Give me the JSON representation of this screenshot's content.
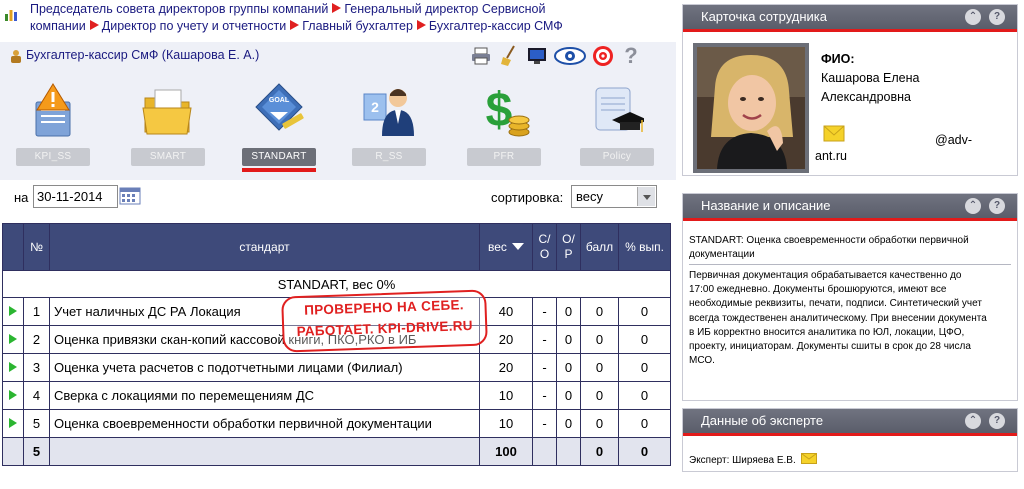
{
  "breadcrumb": {
    "line1": [
      "Председатель совета директоров группы компаний",
      "Генеральный директор Сервисной"
    ],
    "line2": [
      "компании",
      "Директор по учету и отчетности",
      "Главный бухгалтер",
      "Бухгалтер-кассир СМФ"
    ]
  },
  "user": {
    "name": "Бухгалтер-кассир СмФ  (Кашарова Е. А.)"
  },
  "toolbar": {
    "icons": [
      "printer-icon",
      "broom-icon",
      "monitor-icon",
      "eye-icon",
      "target-icon",
      "help-icon"
    ]
  },
  "modules": [
    {
      "label": "KPI_SS",
      "icon": "warning-doc-icon",
      "active": false
    },
    {
      "label": "SMART",
      "icon": "folder-icon",
      "active": false
    },
    {
      "label": "STANDART",
      "icon": "goal-badge-icon",
      "active": true
    },
    {
      "label": "R_SS",
      "icon": "person-stat-icon",
      "active": false
    },
    {
      "label": "PFR",
      "icon": "dollar-coins-icon",
      "active": false
    },
    {
      "label": "Policy",
      "icon": "graduation-scroll-icon",
      "active": false
    }
  ],
  "filter": {
    "date_label": "на",
    "date_value": "30-11-2014",
    "sort_label": "сортировка:",
    "sort_value": "весу"
  },
  "table": {
    "headers": {
      "num": "№",
      "standard": "стандарт",
      "weight": "вес",
      "co_top": "С/",
      "co_bot": "О",
      "op_top": "О/",
      "op_bot": "Р",
      "score": "балл",
      "pct": "% вып."
    },
    "section": "STANDART, вес 0%",
    "rows": [
      {
        "num": "1",
        "name": "Учет наличных ДС РА Локация",
        "weight": "40",
        "co": "-",
        "op": "0",
        "score": "0",
        "pct": "0"
      },
      {
        "num": "2",
        "name": "Оценка привязки скан-копий кассовой книги, ПКО,РКО в ИБ",
        "weight": "20",
        "co": "-",
        "op": "0",
        "score": "0",
        "pct": "0"
      },
      {
        "num": "3",
        "name": "Оценка учета расчетов с подотчетными лицами (Филиал)",
        "weight": "20",
        "co": "-",
        "op": "0",
        "score": "0",
        "pct": "0"
      },
      {
        "num": "4",
        "name": "Сверка с локациями по перемещениям ДС",
        "weight": "10",
        "co": "-",
        "op": "0",
        "score": "0",
        "pct": "0"
      },
      {
        "num": "5",
        "name": "Оценка своевременности обработки первичной документации",
        "weight": "10",
        "co": "-",
        "op": "0",
        "score": "0",
        "pct": "0"
      }
    ],
    "footer": {
      "num": "5",
      "weight": "100",
      "score": "0",
      "pct": "0"
    }
  },
  "stamp": {
    "line1": "ПРОВЕРЕНО НА СЕБЕ.",
    "line2": "РАБОТАЕТ. KPI-DRIVE.RU"
  },
  "employee_card": {
    "title": "Карточка сотрудника",
    "fio_label": "ФИО:",
    "fio_line1": "Кашарова Елена",
    "fio_line2": "Александровна",
    "email_part1": "@adv-",
    "email_part2": "ant.ru"
  },
  "description": {
    "title": "Название и описание",
    "heading": "STANDART: Оценка своевременности обработки первичной документации",
    "body": "Первичная документация обрабатывается качественно до 17:00 ежедневно. Документы брошюруются, имеют все необходимые реквизиты, печати, подписи. Синтетический учет всегда тождественен аналитическому. При внесении документа в ИБ корректно вносится аналитика по ЮЛ, локации, ЦФО, проекту, инициаторам. Документы сшиты в срок до 28 числа МСО."
  },
  "expert": {
    "title": "Данные об эксперте",
    "text": "Эксперт: Ширяева Е.В."
  },
  "colors": {
    "accent_red": "#e21a1a",
    "table_header": "#3e4a7a",
    "link_blue": "#1a1a80",
    "play_green": "#2bb531"
  }
}
